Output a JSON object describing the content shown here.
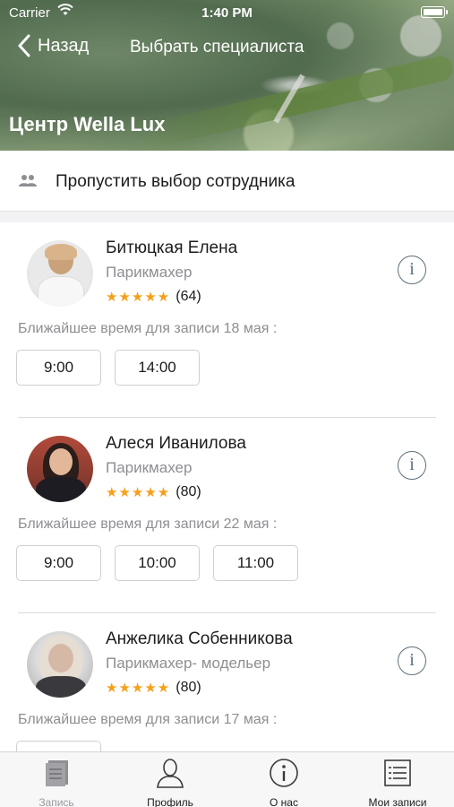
{
  "status_bar": {
    "carrier": "Carrier",
    "time": "1:40 PM"
  },
  "nav": {
    "back_label": "Назад",
    "title": "Выбрать специалиста"
  },
  "center": {
    "name": "Центр Wella Lux"
  },
  "skip": {
    "label": "Пропустить выбор сотрудника"
  },
  "specialists": [
    {
      "name": "Битюцкая Елена",
      "role": "Парикмахер",
      "stars": "★★★★★",
      "rating_count": "(64)",
      "nearest": "Ближайшее время для записи 18 мая :",
      "slots": [
        "9:00",
        "14:00"
      ]
    },
    {
      "name": "Алеся Иванилова",
      "role": "Парикмахер",
      "stars": "★★★★★",
      "rating_count": "(80)",
      "nearest": "Ближайшее время для записи 22 мая :",
      "slots": [
        "9:00",
        "10:00",
        "11:00"
      ]
    },
    {
      "name": "Анжелика Собенникова",
      "role": "Парикмахер- модельер",
      "stars": "★★★★★",
      "rating_count": "(80)",
      "nearest": "Ближайшее время для записи 17 мая :",
      "slots": []
    }
  ],
  "tabbar": {
    "items": [
      {
        "label": "Запись",
        "icon": "book-icon"
      },
      {
        "label": "Профиль",
        "icon": "person-icon"
      },
      {
        "label": "О нас",
        "icon": "info-icon"
      },
      {
        "label": "Мои записи",
        "icon": "list-icon"
      }
    ]
  },
  "colors": {
    "star": "#f5a01a",
    "secondary_text": "#8e8e93",
    "info_icon": "#5c6f7a"
  }
}
